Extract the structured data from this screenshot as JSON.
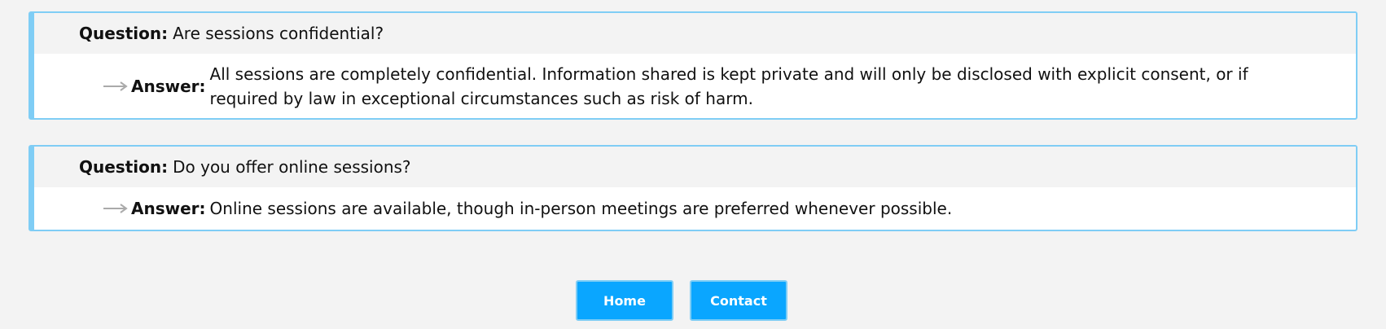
{
  "faq": [
    {
      "question_label": "Question:",
      "question": "Are sessions confidential?",
      "answer_label": "Answer:",
      "answer": "All sessions are completely confidential. Information shared is kept private and will only be disclosed with explicit consent, or if required by law in exceptional circumstances such as risk of harm."
    },
    {
      "question_label": "Question:",
      "question": "Do you offer online sessions?",
      "answer_label": "Answer:",
      "answer": "Online sessions are available, though in-person meetings are preferred whenever possible."
    }
  ],
  "nav": {
    "home_label": "Home",
    "contact_label": "Contact"
  },
  "icons": {
    "answer": "arrow-right-icon"
  },
  "colors": {
    "accent_border": "#7fcdf5",
    "button_bg": "#0aa6ff",
    "page_bg": "#f3f3f3"
  }
}
